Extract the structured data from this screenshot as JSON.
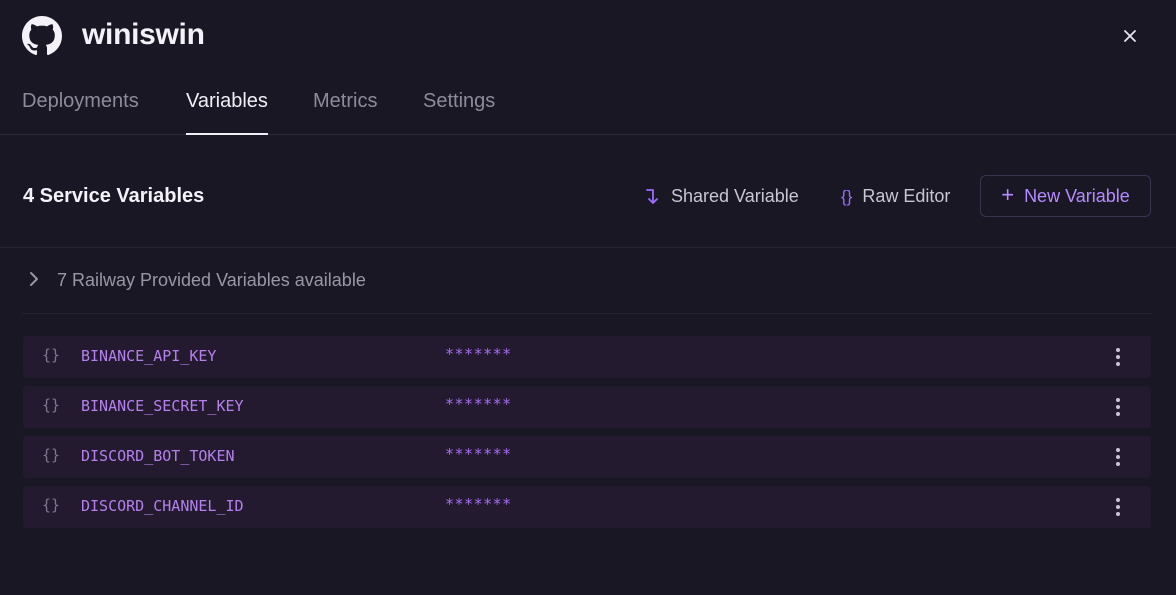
{
  "project": {
    "name": "winiswin",
    "logo_icon": "github-icon"
  },
  "tabs": [
    {
      "label": "Deployments",
      "active": false
    },
    {
      "label": "Variables",
      "active": true
    },
    {
      "label": "Metrics",
      "active": false
    },
    {
      "label": "Settings",
      "active": false
    }
  ],
  "section": {
    "title": "4 Service Variables",
    "shared_variable_label": "Shared Variable",
    "raw_editor_label": "Raw Editor",
    "raw_editor_icon_text": "{}",
    "new_variable_label": "New Variable",
    "new_variable_icon_text": "+"
  },
  "provided": {
    "label": "7 Railway Provided Variables available"
  },
  "variables": [
    {
      "icon_text": "{}",
      "name": "BINANCE_API_KEY",
      "value": "*******"
    },
    {
      "icon_text": "{}",
      "name": "BINANCE_SECRET_KEY",
      "value": "*******"
    },
    {
      "icon_text": "{}",
      "name": "DISCORD_BOT_TOKEN",
      "value": "*******"
    },
    {
      "icon_text": "{}",
      "name": "DISCORD_CHANNEL_ID",
      "value": "*******"
    }
  ],
  "colors": {
    "background": "#1a1724",
    "accent": "#9b6cff",
    "row_background": "#231a30",
    "variable_name": "#b480ec"
  }
}
